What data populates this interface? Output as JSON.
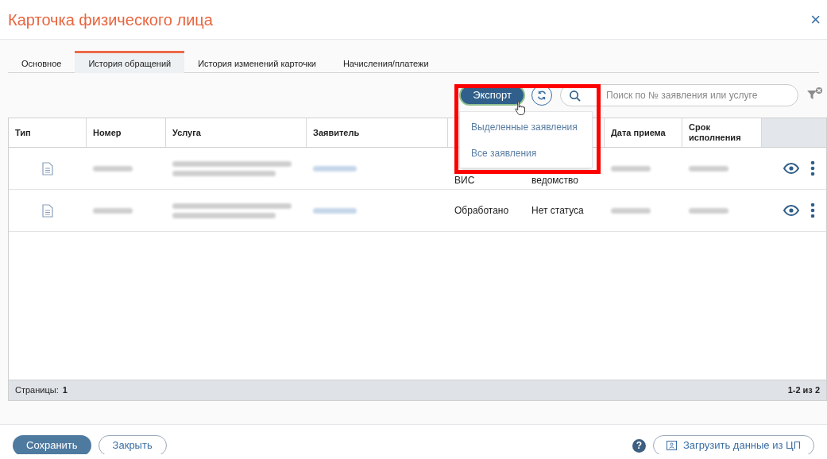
{
  "window": {
    "title": "Карточка физического лица",
    "close": "×"
  },
  "tabs": [
    {
      "label": "Основное",
      "selected": false
    },
    {
      "label": "История обращений",
      "selected": true
    },
    {
      "label": "История изменений карточки",
      "selected": false
    },
    {
      "label": "Начисления/платежи",
      "selected": false
    }
  ],
  "toolbar": {
    "export_button": "Экспорт",
    "search": {
      "placeholder": "Поиск по № заявления или услуге"
    }
  },
  "export_menu": [
    "Выделенные заявления",
    "Все заявления"
  ],
  "table": {
    "columns": [
      "Тип",
      "Номер",
      "Услуга",
      "Заявитель",
      "",
      "",
      "Дата приема",
      "Срок исполнения"
    ],
    "rows": [
      {
        "column_5": "ВИС",
        "column_6": "ведомство"
      },
      {
        "column_5": "Обработано",
        "column_6": "Нет статуса"
      }
    ]
  },
  "pager": {
    "pages_label": "Страницы:",
    "pages": "1",
    "range": "1-2 из 2"
  },
  "footer": {
    "save": "Сохранить",
    "close": "Закрыть",
    "help": "?",
    "load": "Загрузить данные из ЦП"
  }
}
